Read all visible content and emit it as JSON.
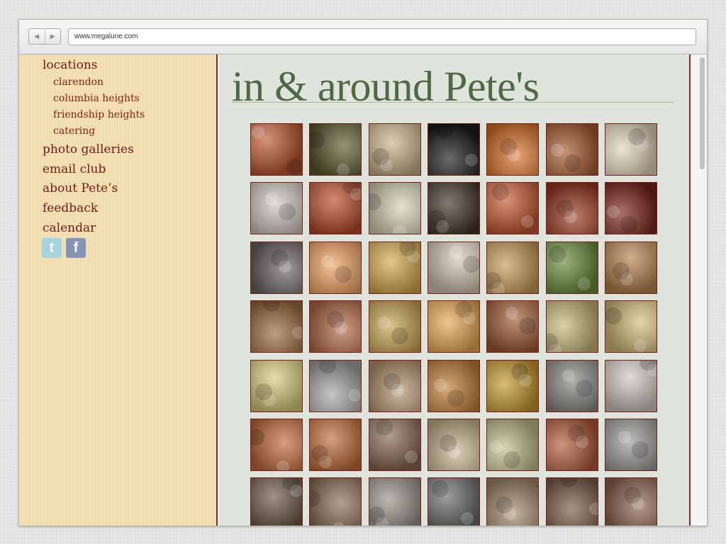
{
  "browser": {
    "url": "www.megalune.com",
    "back_icon": "back-arrow-icon",
    "forward_icon": "forward-arrow-icon"
  },
  "sidebar": {
    "locations": "locations",
    "sub_items": [
      "clarendon",
      "columbia heights",
      "friendship heights",
      "catering"
    ],
    "main_items": [
      "photo galleries",
      "email club",
      "about Pete’s",
      "feedback",
      "calendar"
    ],
    "social_icons": [
      "twitter-icon",
      "facebook-icon"
    ]
  },
  "main": {
    "title": "in & around Pete's"
  },
  "gallery": {
    "rows": 7,
    "cols": 7,
    "colors": [
      [
        "#c05a33",
        "#5a5a2e",
        "#c9b48a",
        "#1b1b1b",
        "#d9732d",
        "#a65a2f",
        "#e3d6bb"
      ],
      [
        "#cfc7c0",
        "#b94c2b",
        "#d9d3b8",
        "#3d3424",
        "#c65a34",
        "#9c3a22",
        "#7a2518"
      ],
      [
        "#6d6565",
        "#f0a060",
        "#d4a94c",
        "#d6c9b5",
        "#c79b55",
        "#6a8d3a",
        "#b9834e"
      ],
      [
        "#9b6a3c",
        "#b46a4a",
        "#c6a24e",
        "#e7a752",
        "#a05a30",
        "#c6b87a",
        "#d4c07a"
      ],
      [
        "#d8cc7a",
        "#a6a6a4",
        "#b4946e",
        "#c07c32",
        "#c4962e",
        "#8a8782",
        "#cfc9c1"
      ],
      [
        "#c46a3a",
        "#c16b36",
        "#8a6a52",
        "#c9b591",
        "#c1bf8a",
        "#b25a3a",
        "#9a9a96"
      ],
      [
        "#6a5746",
        "#8a6f55",
        "#9a928a",
        "#6d6c6c",
        "#a28b6b",
        "#7a5a48",
        "#8d6651"
      ]
    ],
    "accent": "#7a1b14"
  },
  "colors": {
    "sidebar_bg": "#f3dfb2",
    "main_bg": "#dfe5dc",
    "nav_text": "#7a1912",
    "title_green": "#4f6a43"
  }
}
